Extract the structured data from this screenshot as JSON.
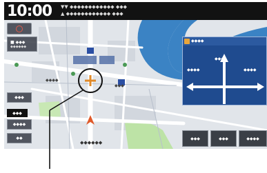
{
  "status": {
    "time": "10:00",
    "line1": "▼▼ ◆◆◆◆◆◆◆◆◆◆◆◆ ◆◆◆",
    "line2": "▲ ◆◆◆◆◆◆◆◆◆◆◆◆ ◆◆◆"
  },
  "left_panel": {
    "compass_label": "N",
    "mode_label": "■ ◆◆◆",
    "mode_sub": "◆◆◆◆◆◆",
    "btn1": "◆◆◆",
    "btn2": "◆◆◆◆",
    "btn3": "◆◆",
    "scale": "◆◆◆"
  },
  "map": {
    "label_a": "◆◆◆◆",
    "label_b": "◆◆◆",
    "label_c": "◆◆◆◆◆◆"
  },
  "guide": {
    "title": "◆◆◆◆",
    "label_top": "◆◆◆",
    "label_left": "◆◆◆◆",
    "label_right": "◆◆◆◆"
  },
  "bottom": {
    "btn1": "◆◆◆",
    "btn2": "◆◆◆",
    "btn3": "◆◆◆◆"
  },
  "colors": {
    "river": "#3b83c4",
    "park": "#bde3a6",
    "road": "#ffffff",
    "cursor": "#e08a2a",
    "vehicle": "#e05a2a"
  }
}
